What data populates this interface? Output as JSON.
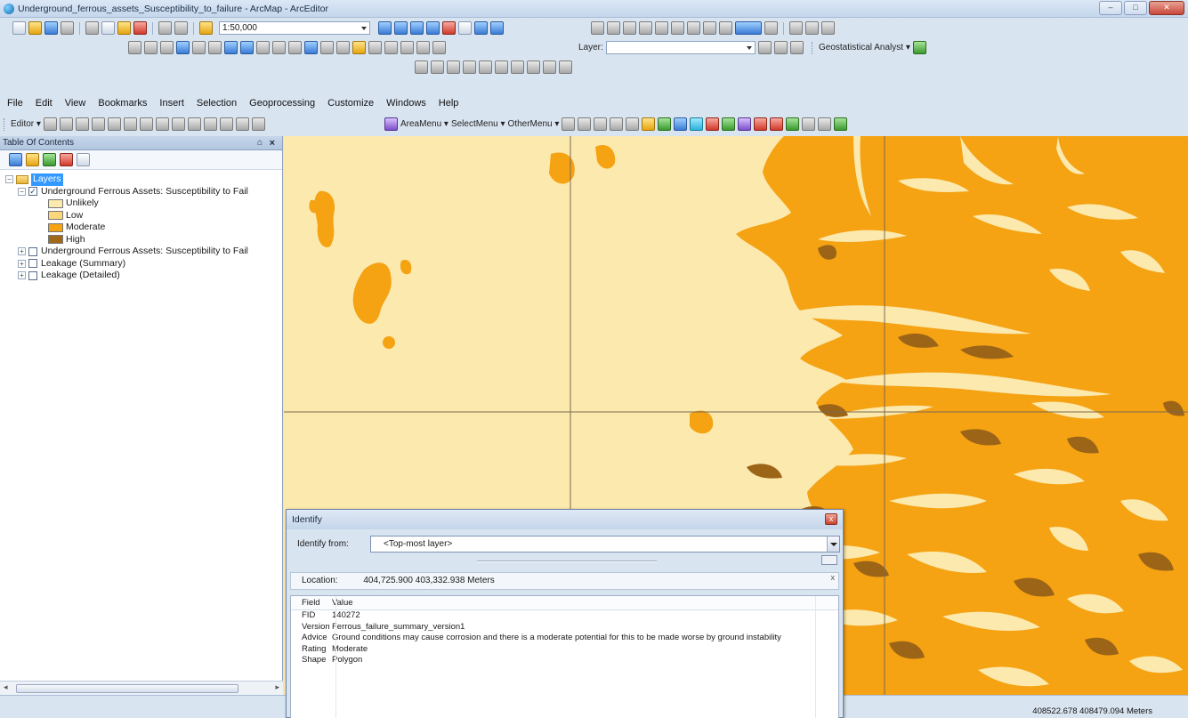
{
  "window": {
    "title": "Underground_ferrous_assets_Susceptibility_to_failure - ArcMap - ArcEditor",
    "controls": {
      "minimize": "–",
      "maximize": "□",
      "close": "✕"
    }
  },
  "toolbar": {
    "scale": "1:50,000",
    "layer_label": "Layer:",
    "layer_value": "",
    "geostatistical_label": "Geostatistical Analyst ▾",
    "editor_label": "Editor ▾",
    "area_menu": "AreaMenu ▾",
    "select_menu": "SelectMenu ▾",
    "other_menu": "OtherMenu ▾"
  },
  "menubar": {
    "items": [
      "File",
      "Edit",
      "View",
      "Bookmarks",
      "Insert",
      "Selection",
      "Geoprocessing",
      "Customize",
      "Windows",
      "Help"
    ]
  },
  "toc": {
    "title": "Table Of Contents",
    "pin": "⌂",
    "close": "×",
    "root_label": "Layers",
    "layer_active": "Underground Ferrous Assets: Susceptibility to Fail",
    "legend": [
      {
        "label": "Unlikely",
        "color": "#fce9ad"
      },
      {
        "label": "Low",
        "color": "#fcd779"
      },
      {
        "label": "Moderate",
        "color": "#f5a213"
      },
      {
        "label": "High",
        "color": "#a0691a"
      }
    ],
    "other_layers": [
      "Underground Ferrous Assets: Susceptibility to Fail",
      "Leakage (Summary)",
      "Leakage (Detailed)"
    ]
  },
  "map": {
    "background_color": "#fce9ad",
    "moderate_color": "#f5a213",
    "high_color": "#9b6417",
    "grid_color": "#7a6a50"
  },
  "status": {
    "coordinates": "408522.678  408479.094 Meters"
  },
  "identify": {
    "title": "Identify",
    "close": "x",
    "from_label": "Identify from:",
    "from_value": "<Top-most layer>",
    "location_label": "Location:",
    "location_value": "404,725.900  403,332.938 Meters",
    "location_close": "x",
    "columns": [
      "Field",
      "Value"
    ],
    "rows": [
      {
        "field": "FID",
        "value": "140272"
      },
      {
        "field": "Version",
        "value": "Ferrous_failure_summary_version1"
      },
      {
        "field": "Advice",
        "value": "Ground conditions may cause corrosion and there is a moderate potential for this to be made worse by ground instability"
      },
      {
        "field": "Rating",
        "value": "Moderate"
      },
      {
        "field": "Shape",
        "value": "Polygon"
      }
    ]
  }
}
